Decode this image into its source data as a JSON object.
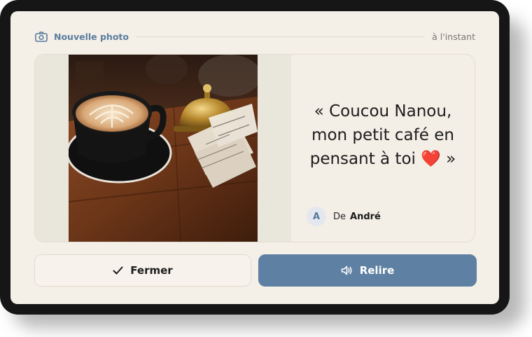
{
  "header": {
    "icon": "camera-icon",
    "title": "Nouvelle photo",
    "timestamp": "à l'instant"
  },
  "photo": {
    "icon": "coffee-photo"
  },
  "message": {
    "text_before": "« Coucou Nanou, mon petit café en pensant à toi ",
    "emoji": "❤️",
    "text_after": " »"
  },
  "sender": {
    "avatar_initial": "A",
    "prefix": "De",
    "name": "André"
  },
  "actions": {
    "close": {
      "label": "Fermer",
      "icon": "check-icon"
    },
    "reread": {
      "label": "Relire",
      "icon": "speaker-icon"
    }
  },
  "colors": {
    "accent": "#5e80a2",
    "background": "#f4efe7",
    "device": "#161616"
  }
}
